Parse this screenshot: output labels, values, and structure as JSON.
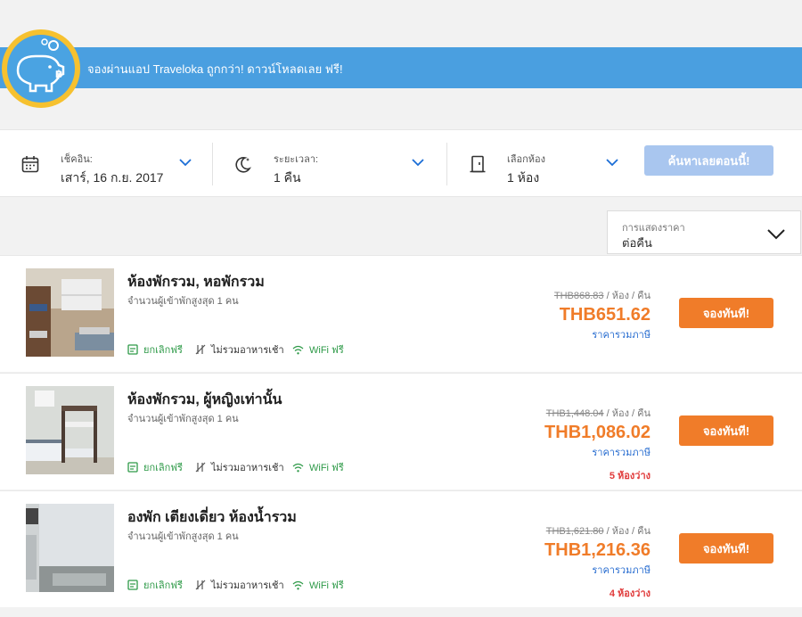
{
  "banner": {
    "text": "จองผ่านแอป Traveloka ถูกกว่า! ดาวน์โหลดเลย ฟรี!"
  },
  "search": {
    "checkin": {
      "label": "เช็คอิน:",
      "value": "เสาร์, 16 ก.ย. 2017"
    },
    "duration": {
      "label": "ระยะเวลา:",
      "value": "1 คืน"
    },
    "rooms": {
      "label": "เลือกห้อง",
      "value": "1 ห้อง"
    },
    "button": "ค้นหาเลยตอนนี้!"
  },
  "price_display": {
    "label": "การแสดงราคา",
    "value": "ต่อคืน"
  },
  "rooms": [
    {
      "title": "ห้องพักรวม, หอพักรวม",
      "occupancy": "จำนวนผู้เข้าพักสูงสุด 1 คน",
      "original_price": "THB868.83",
      "per_unit": "/ ห้อง / คืน",
      "price": "THB651.62",
      "tax_note": "ราคารวมภาษี",
      "availability": "",
      "amenities": [
        "ยกเลิกฟรี",
        "ไม่รวมอาหารเช้า",
        "WiFi ฟรี"
      ],
      "book": "จองทันที!"
    },
    {
      "title": "ห้องพักรวม, ผู้หญิงเท่านั้น",
      "occupancy": "จำนวนผู้เข้าพักสูงสุด 1 คน",
      "original_price": "THB1,448.04",
      "per_unit": "/ ห้อง / คืน",
      "price": "THB1,086.02",
      "tax_note": "ราคารวมภาษี",
      "availability": "5 ห้องว่าง",
      "amenities": [
        "ยกเลิกฟรี",
        "ไม่รวมอาหารเช้า",
        "WiFi ฟรี"
      ],
      "book": "จองทันที!"
    },
    {
      "title": "องพัก เตียงเดี่ยว ห้องน้ำรวม",
      "occupancy": "จำนวนผู้เข้าพักสูงสุด 1 คน",
      "original_price": "THB1,621.80",
      "per_unit": "/ ห้อง / คืน",
      "price": "THB1,216.36",
      "tax_note": "ราคารวมภาษี",
      "availability": "4 ห้องว่าง",
      "amenities": [
        "ยกเลิกฟรี",
        "ไม่รวมอาหารเช้า",
        "WiFi ฟรี"
      ],
      "book": "จองทันที!"
    }
  ],
  "colors": {
    "banner": "#4a9fe0",
    "accent_orange": "#f07c29",
    "tax_blue": "#2b6fd1",
    "amenity_green": "#2e9a48",
    "availability_red": "#e03a3a"
  }
}
